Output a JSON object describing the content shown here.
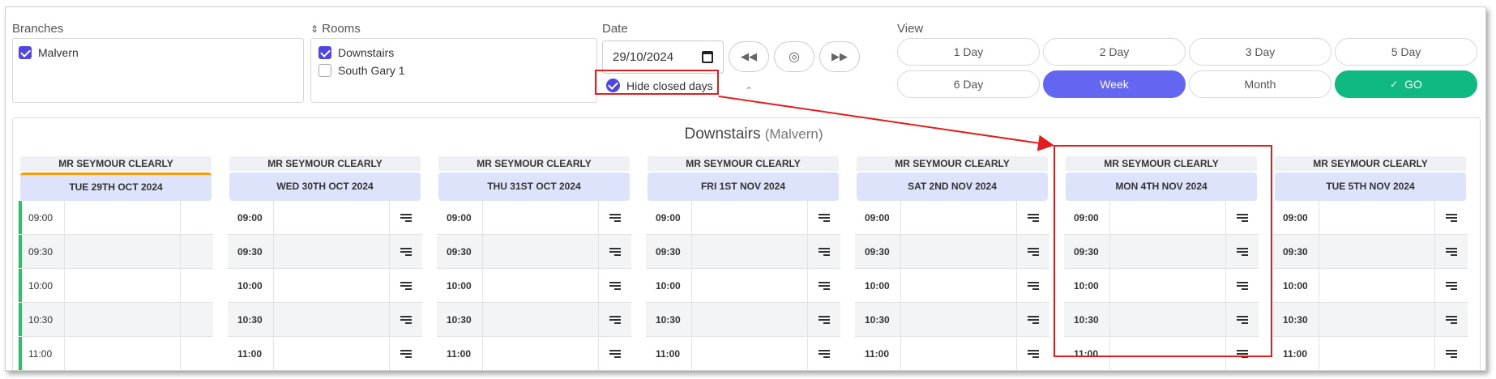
{
  "filters": {
    "branches": {
      "label": "Branches",
      "items": [
        {
          "name": "Malvern",
          "checked": true
        }
      ]
    },
    "rooms": {
      "label": "Rooms",
      "items": [
        {
          "name": "Downstairs",
          "checked": true
        },
        {
          "name": "South Gary 1",
          "checked": false
        }
      ]
    },
    "date": {
      "label": "Date",
      "value": "29/10/2024",
      "hide_closed_label": "Hide closed days",
      "hide_closed_checked": true
    },
    "view": {
      "label": "View",
      "options": [
        "1 Day",
        "2 Day",
        "3 Day",
        "5 Day",
        "6 Day",
        "Week",
        "Month"
      ],
      "active": "Week",
      "go_label": "GO",
      "go_check": "✓"
    }
  },
  "schedule": {
    "room": "Downstairs",
    "branch": "(Malvern)",
    "columns": [
      {
        "staff": "MR SEYMOUR CLEARLY",
        "day": "TUE 29TH OCT 2024"
      },
      {
        "staff": "MR SEYMOUR CLEARLY",
        "day": "WED 30TH OCT 2024"
      },
      {
        "staff": "MR SEYMOUR CLEARLY",
        "day": "THU 31ST OCT 2024"
      },
      {
        "staff": "MR SEYMOUR CLEARLY",
        "day": "FRI 1ST NOV 2024"
      },
      {
        "staff": "MR SEYMOUR CLEARLY",
        "day": "SAT 2ND NOV 2024"
      },
      {
        "staff": "MR SEYMOUR CLEARLY",
        "day": "MON 4TH NOV 2024"
      },
      {
        "staff": "MR SEYMOUR CLEARLY",
        "day": "TUE 5TH NOV 2024"
      }
    ],
    "times": [
      "09:00",
      "09:30",
      "10:00",
      "10:30",
      "11:00"
    ]
  },
  "colors": {
    "accent": "#4f46e5",
    "active_view": "#6366f1",
    "go": "#10b981",
    "annotation": "#e11d1d",
    "today_bar": "#22c55e"
  }
}
